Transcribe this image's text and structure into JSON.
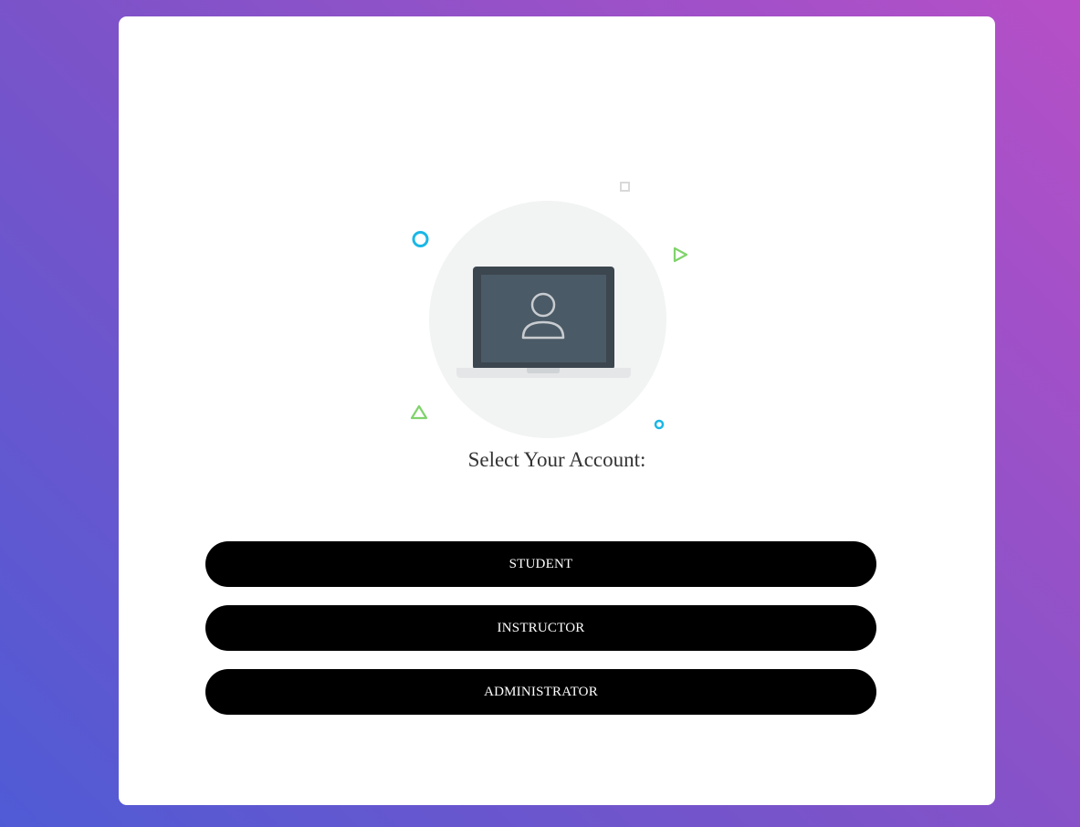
{
  "illustration": {
    "icon": "laptop-user-icon",
    "colors": {
      "circle_bg": "#f2f3f3",
      "laptop_frame": "#3c464f",
      "laptop_screen": "#4a5a66",
      "laptop_base": "#e4e6e7",
      "user_glyph": "#c8ccd0",
      "accent_blue": "#1ab7e6",
      "accent_green": "#7fd36b",
      "accent_gray": "#d9d9d9"
    }
  },
  "prompt": "Select Your Account:",
  "roles": [
    {
      "label": "STUDENT"
    },
    {
      "label": "INSTRUCTOR"
    },
    {
      "label": "ADMINISTRATOR"
    }
  ],
  "colors": {
    "button_bg": "#000000",
    "button_text": "#ffffff",
    "card_bg": "#ffffff",
    "gradient_start": "#4f5bd5",
    "gradient_end": "#b64fc7"
  }
}
